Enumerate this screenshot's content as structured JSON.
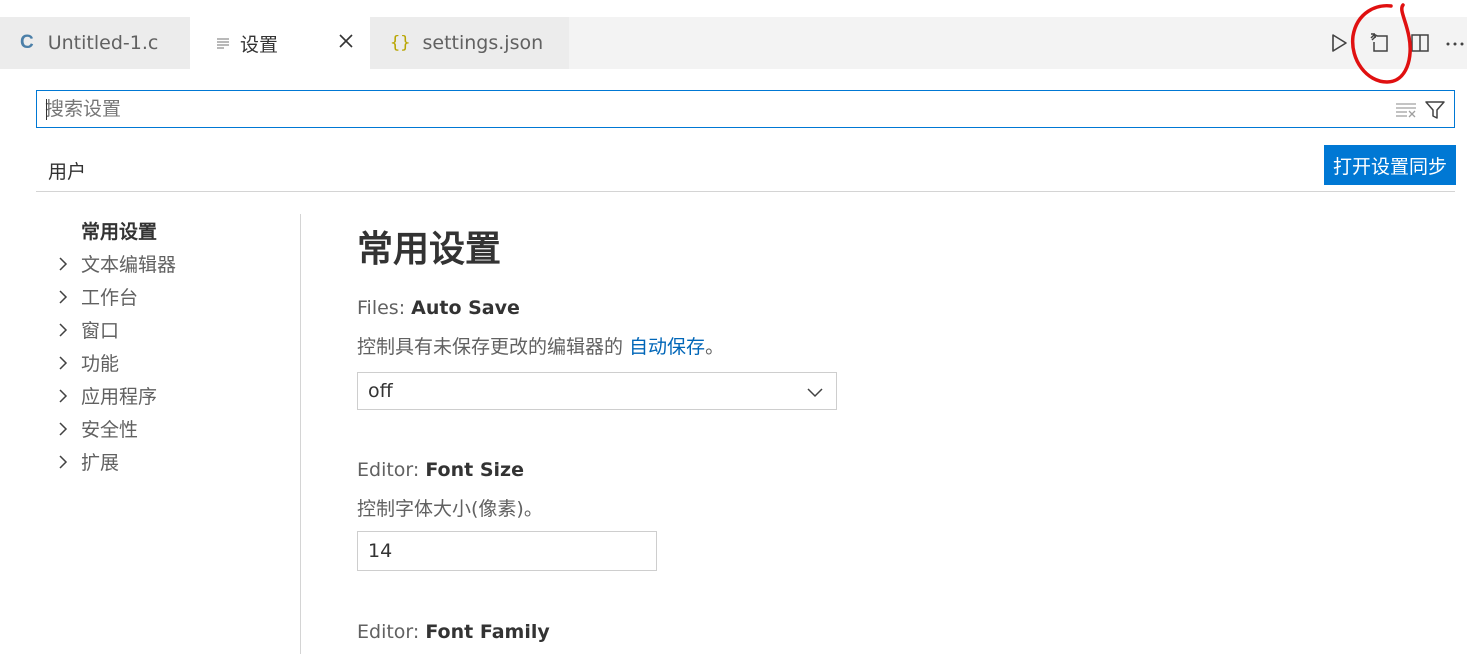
{
  "tabs": [
    {
      "label": "Untitled-1.c",
      "icon": "c-file-icon",
      "active": false
    },
    {
      "label": "设置",
      "icon": "settings-lines-icon",
      "active": true,
      "closable": true
    },
    {
      "label": "settings.json",
      "icon": "json-braces-icon",
      "active": false
    }
  ],
  "tab_glyphs": {
    "c": "C",
    "braces": "{}"
  },
  "editor_actions": [
    "run-icon",
    "open-settings-json-icon",
    "split-editor-icon",
    "more-actions-icon"
  ],
  "search": {
    "placeholder": "搜索设置",
    "value": ""
  },
  "scope_tab": "用户",
  "sync_button": "打开设置同步",
  "toc": [
    {
      "label": "常用设置",
      "expandable": false,
      "active": true
    },
    {
      "label": "文本编辑器",
      "expandable": true
    },
    {
      "label": "工作台",
      "expandable": true
    },
    {
      "label": "窗口",
      "expandable": true
    },
    {
      "label": "功能",
      "expandable": true
    },
    {
      "label": "应用程序",
      "expandable": true
    },
    {
      "label": "安全性",
      "expandable": true
    },
    {
      "label": "扩展",
      "expandable": true
    }
  ],
  "content": {
    "section_title": "常用设置",
    "settings": [
      {
        "category": "Files: ",
        "key": "Auto Save",
        "description_before": "控制具有未保存更改的编辑器的 ",
        "description_link": "自动保存",
        "description_after": "。",
        "control": "select",
        "value": "off"
      },
      {
        "category": "Editor: ",
        "key": "Font Size",
        "description": "控制字体大小(像素)。",
        "control": "number",
        "value": "14"
      },
      {
        "category": "Editor: ",
        "key": "Font Family"
      }
    ]
  },
  "colors": {
    "accent": "#0078d4",
    "link": "#0066b8",
    "annotation": "#e01010",
    "json_icon": "#b8a500",
    "c_icon": "#4b7fa8"
  }
}
